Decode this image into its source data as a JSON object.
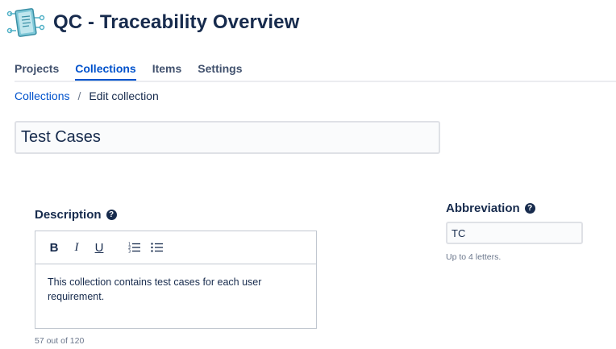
{
  "app": {
    "title": "QC - Traceability Overview",
    "logo_icon": "document-network-icon"
  },
  "nav": {
    "tabs": [
      {
        "label": "Projects",
        "active": false
      },
      {
        "label": "Collections",
        "active": true
      },
      {
        "label": "Items",
        "active": false
      },
      {
        "label": "Settings",
        "active": false
      }
    ]
  },
  "breadcrumb": {
    "parent": "Collections",
    "separator": "/",
    "current": "Edit collection"
  },
  "collection": {
    "name": "Test Cases"
  },
  "description": {
    "label": "Description",
    "help_icon": "question-circle-icon",
    "toolbar": {
      "bold": "B",
      "italic": "I",
      "underline": "U",
      "numbered_list_icon": "numbered-list-icon",
      "bullet_list_icon": "bullet-list-icon"
    },
    "text": "This collection contains test cases for each user requirement.",
    "counter": "57 out of 120"
  },
  "abbreviation": {
    "label": "Abbreviation",
    "help_icon": "question-circle-icon",
    "value": "TC",
    "hint": "Up to 4 letters."
  },
  "colors": {
    "accent": "#0052cc",
    "text": "#172b4d",
    "muted": "#6b778c",
    "border": "#dfe1e6"
  }
}
